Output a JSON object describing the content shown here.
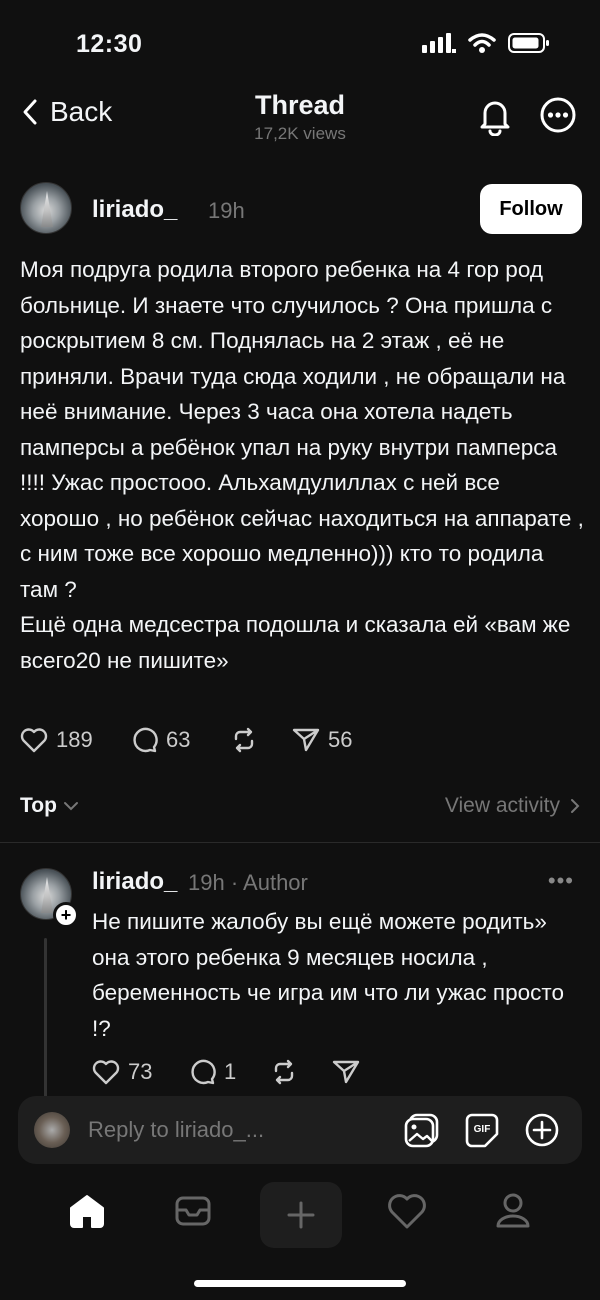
{
  "status": {
    "time": "12:30"
  },
  "nav": {
    "back_label": "Back",
    "title": "Thread",
    "views": "17,2K views"
  },
  "post": {
    "username": "liriado_",
    "time": "19h",
    "follow_label": "Follow",
    "paragraphs": [
      "Моя подруга родила второго ребенка на 4 гор род больнице. И знаете что случилось ? Она пришла с роскрытием 8 см. Поднялась на 2 этаж , её не приняли. Врачи туда сюда ходили , не обращали на неё внимание. Через 3 часа она хотела надеть памперсы а ребёнок упал на руку внутри памперса !!!! Ужас простооо. Альхамдулиллах с ней все хорошо , но ребёнок сейчас находиться на аппарате , с ним тоже все хорошо медленно))) кто то родила там ?",
      "Ещё одна медсестра подошла и сказала ей «вам же всего20 не пишите»"
    ],
    "likes": "189",
    "comments": "63",
    "shares": "56"
  },
  "sort": {
    "label": "Top",
    "view_activity": "View activity"
  },
  "reply": {
    "username": "liriado_",
    "meta": "19h · Author",
    "more": "•••",
    "text": "Не пишите жалобу вы ещё можете родить» она этого ребенка 9 месяцев носила , беременность че игра им что ли ужас просто !?",
    "likes": "73",
    "comments": "1"
  },
  "reply_bar": {
    "placeholder": "Reply to liriado_..."
  },
  "colors": {
    "background": "#101010",
    "text": "#f3f5f7",
    "muted": "#777777",
    "follow_bg": "#ffffff"
  },
  "icons": [
    "chevron-left-icon",
    "bell-icon",
    "more-circle-icon",
    "heart-icon",
    "comment-icon",
    "repost-icon",
    "send-icon",
    "chevron-down-icon",
    "chevron-right-icon",
    "image-icon",
    "gif-icon",
    "plus-circle-icon",
    "home-icon",
    "inbox-icon",
    "plus-icon",
    "person-icon"
  ]
}
